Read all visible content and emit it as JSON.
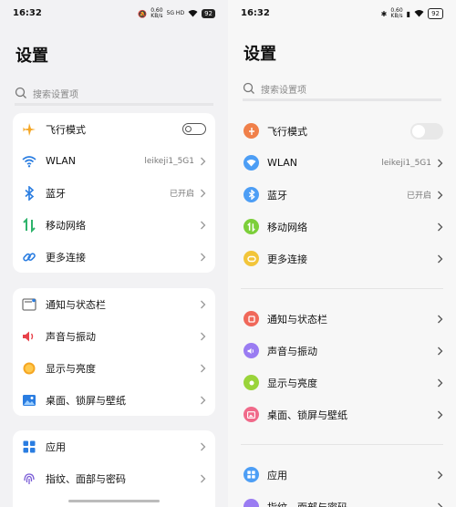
{
  "left": {
    "status": {
      "time": "16:32",
      "speed_top": "0.60",
      "speed_bottom": "KB/s",
      "net": "5G HD",
      "battery": "92"
    },
    "title": "设置",
    "search": {
      "placeholder": "搜索设置项"
    },
    "group1": [
      {
        "label": "飞行模式",
        "icon": "airplane-icon"
      },
      {
        "label": "WLAN",
        "value": "leikeji1_5G1",
        "icon": "wifi-icon"
      },
      {
        "label": "蓝牙",
        "value": "已开启",
        "icon": "bluetooth-icon"
      },
      {
        "label": "移动网络",
        "icon": "mobile-data-icon"
      },
      {
        "label": "更多连接",
        "icon": "link-icon"
      }
    ],
    "group2": [
      {
        "label": "通知与状态栏",
        "icon": "notification-icon"
      },
      {
        "label": "声音与振动",
        "icon": "sound-icon"
      },
      {
        "label": "显示与亮度",
        "icon": "brightness-icon"
      },
      {
        "label": "桌面、锁屏与壁纸",
        "icon": "wallpaper-icon"
      }
    ],
    "group3": [
      {
        "label": "应用",
        "icon": "apps-icon"
      },
      {
        "label": "指纹、面部与密码",
        "icon": "fingerprint-icon"
      }
    ]
  },
  "right": {
    "status": {
      "time": "16:32",
      "speed_top": "0.60",
      "speed_bottom": "KB/s",
      "battery": "92"
    },
    "title": "设置",
    "search": {
      "placeholder": "搜索设置项"
    },
    "group1": [
      {
        "label": "飞行模式",
        "icon": "airplane-icon",
        "color": "#f0804a"
      },
      {
        "label": "WLAN",
        "value": "leikeji1_5G1",
        "icon": "wifi-icon",
        "color": "#4d9ef5"
      },
      {
        "label": "蓝牙",
        "value": "已开启",
        "icon": "bluetooth-icon",
        "color": "#4d9ef5"
      },
      {
        "label": "移动网络",
        "icon": "mobile-data-icon",
        "color": "#7ccf3a"
      },
      {
        "label": "更多连接",
        "icon": "link-icon",
        "color": "#f2c53a"
      }
    ],
    "group2": [
      {
        "label": "通知与状态栏",
        "icon": "notification-icon",
        "color": "#f0685a"
      },
      {
        "label": "声音与振动",
        "icon": "sound-icon",
        "color": "#9a7cf2"
      },
      {
        "label": "显示与亮度",
        "icon": "brightness-icon",
        "color": "#9ad43a"
      },
      {
        "label": "桌面、锁屏与壁纸",
        "icon": "wallpaper-icon",
        "color": "#f06a8a"
      }
    ],
    "group3": [
      {
        "label": "应用",
        "icon": "apps-icon",
        "color": "#4d9ef5"
      },
      {
        "label": "指纹、面部与密码",
        "icon": "fingerprint-icon",
        "color": "#9a7cf2"
      }
    ]
  }
}
